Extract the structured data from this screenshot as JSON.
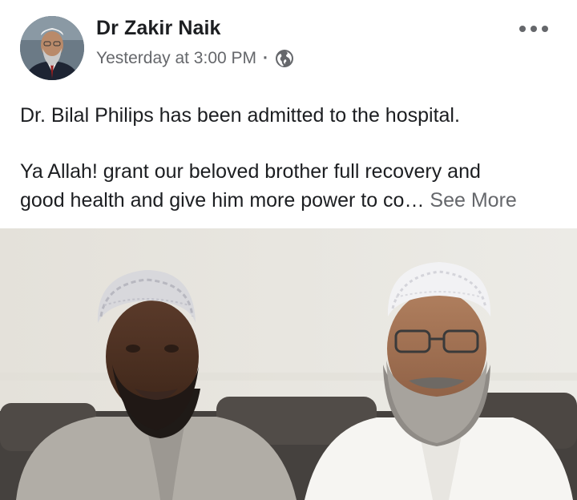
{
  "post": {
    "author_name": "Dr Zakir Naik",
    "timestamp": "Yesterday at 3:00 PM",
    "separator": "·",
    "privacy_icon": "globe-icon",
    "more_icon": "more-options-icon",
    "text_line_1": "Dr. Bilal Philips has been admitted to the hospital.",
    "text_line_2": "Ya Allah! grant our beloved brother full recovery and",
    "text_line_3": "good health and give him more power to co…",
    "see_more_label": "See More"
  },
  "colors": {
    "primary_text": "#1c1e21",
    "secondary_text": "#65676b",
    "background": "#ffffff"
  }
}
